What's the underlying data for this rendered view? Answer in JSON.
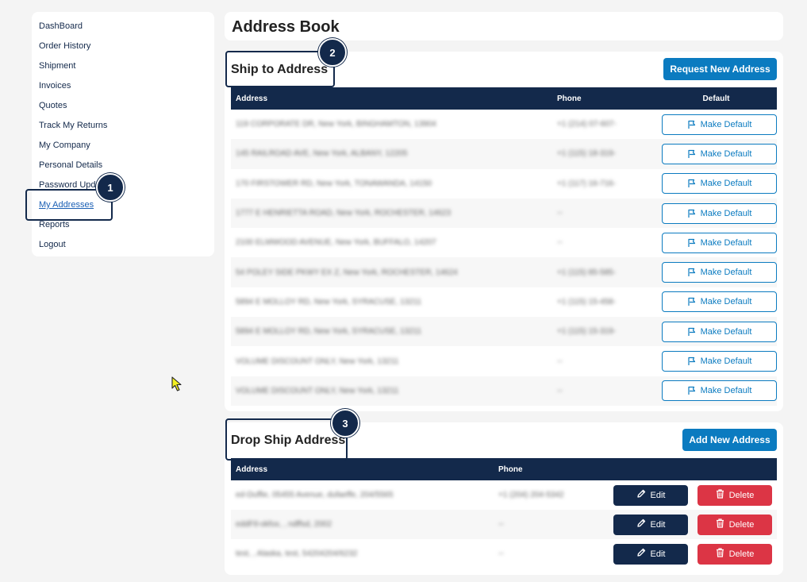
{
  "sidebar": {
    "items": [
      {
        "label": "DashBoard"
      },
      {
        "label": "Order History"
      },
      {
        "label": "Shipment"
      },
      {
        "label": "Invoices"
      },
      {
        "label": "Quotes"
      },
      {
        "label": "Track My Returns"
      },
      {
        "label": "My Company"
      },
      {
        "label": "Personal Details"
      },
      {
        "label": "Password Update"
      },
      {
        "label": "My Addresses",
        "active": true
      },
      {
        "label": "Reports"
      },
      {
        "label": "Logout"
      }
    ]
  },
  "annotations": {
    "one": "1",
    "two": "2",
    "three": "3"
  },
  "page": {
    "title": "Address Book"
  },
  "ship": {
    "title": "Ship to Address",
    "request_button": "Request New Address",
    "headers": {
      "address": "Address",
      "phone": "Phone",
      "default": "Default"
    },
    "make_default_label": "Make Default",
    "rows": [
      {
        "address": "119 CORPORATE DR, New York, BINGHAMTON, 13904",
        "phone": "+1 (214) 07-607-"
      },
      {
        "address": "145 RAILROAD AVE, New York, ALBANY, 12205",
        "phone": "+1 (115) 18-319-"
      },
      {
        "address": "170 FIRSTOWER RD, New York, TONAWANDA, 14150",
        "phone": "+1 (117) 16-716-"
      },
      {
        "address": "1777 E HENRIETTA ROAD, New York, ROCHESTER, 14623",
        "phone": "--"
      },
      {
        "address": "2100 ELMWOOD AVENUE, New York, BUFFALO, 14207",
        "phone": "--"
      },
      {
        "address": "54 POLEY SIDE PKWY EX Z, New York, ROCHESTER, 14624",
        "phone": "+1 (115) 85-585-"
      },
      {
        "address": "5894 E MOLLOY RD, New York, SYRACUSE, 13211",
        "phone": "+1 (115) 15-458-"
      },
      {
        "address": "5894 E MOLLOY RD, New York, SYRACUSE, 13211",
        "phone": "+1 (115) 15-319-"
      },
      {
        "address": "VOLUME DISCOUNT ONLY, New York, 13211",
        "phone": "--"
      },
      {
        "address": "VOLUME DISCOUNT ONLY, New York, 13211",
        "phone": "--"
      }
    ]
  },
  "drop": {
    "title": "Drop Ship Address",
    "add_button": "Add New Address",
    "headers": {
      "address": "Address",
      "phone": "Phone"
    },
    "edit_label": "Edit",
    "delete_label": "Delete",
    "rows": [
      {
        "address": "ed-Duffie, 05455 Avenue, dufaeffe, 204/5565",
        "phone": "+1 (204) 204-5342"
      },
      {
        "address": "eddFtl-okfox, , ndffsd, 2002",
        "phone": "--"
      },
      {
        "address": "test, , Alaska, test, 54204204/6232",
        "phone": "--"
      }
    ]
  },
  "colors": {
    "navy": "#13294b",
    "accent": "#0b7bc0",
    "danger": "#dc3545"
  },
  "icons": {
    "flag": "flag-icon",
    "edit": "pencil-icon",
    "delete": "trash-icon",
    "cursor": "mouse-pointer-icon"
  }
}
